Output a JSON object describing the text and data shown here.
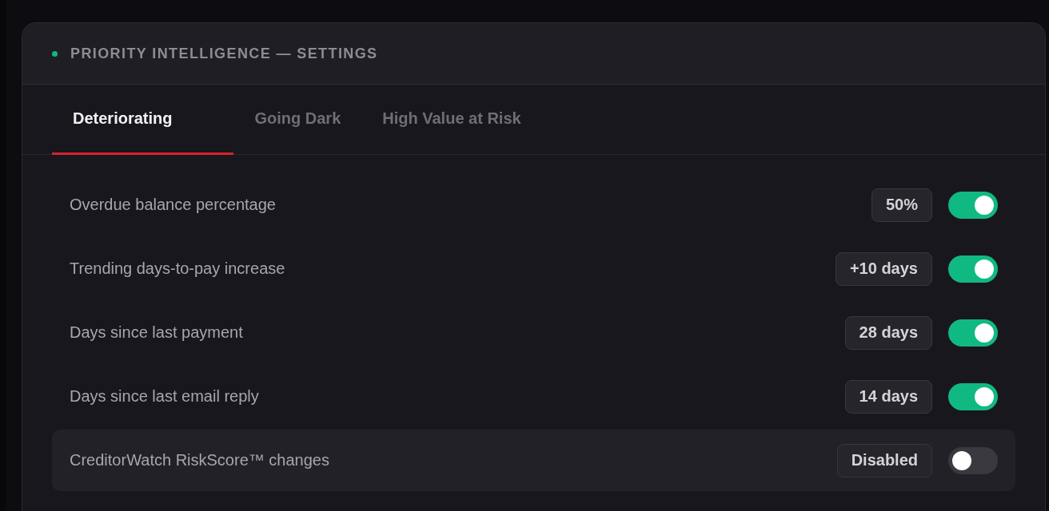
{
  "panel": {
    "title": "PRIORITY INTELLIGENCE — SETTINGS"
  },
  "tabs": [
    {
      "label": "Deteriorating",
      "selected": true
    },
    {
      "label": "Going Dark",
      "selected": false
    },
    {
      "label": "High Value at Risk",
      "selected": false
    }
  ],
  "settings": [
    {
      "label": "Overdue balance percentage",
      "value": "50%",
      "on": true,
      "highlighted": false
    },
    {
      "label": "Trending days-to-pay increase",
      "value": "+10 days",
      "on": true,
      "highlighted": false
    },
    {
      "label": "Days since last payment",
      "value": "28 days",
      "on": true,
      "highlighted": false
    },
    {
      "label": "Days since last email reply",
      "value": "14 days",
      "on": true,
      "highlighted": false
    },
    {
      "label": "CreditorWatch RiskScore™ changes",
      "value": "Disabled",
      "on": false,
      "highlighted": true
    }
  ]
}
